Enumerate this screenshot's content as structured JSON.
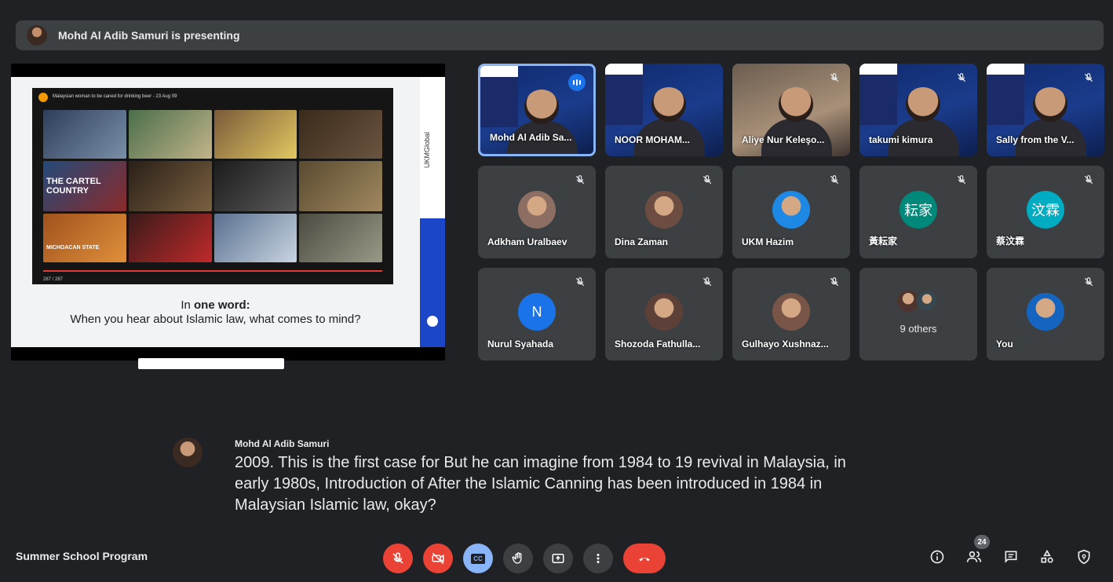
{
  "presenting_bar": {
    "text": "Mohd Al Adib Samuri is presenting"
  },
  "slide": {
    "video_title": "Malaysian woman to be caned for drinking beer - 23 Aug 09",
    "caption_prefix": "In ",
    "caption_bold": "one word:",
    "caption_line2": "When you hear about Islamic law, what comes to mind?",
    "tile_text_1": "THE CARTEL COUNTRY",
    "tile_text_2": "MICHOACAN STATE",
    "time": "287 / 287",
    "vertical_title": "UKMGlobal"
  },
  "tiles": [
    {
      "name": "Mohd Al Adib Sa...",
      "type": "video",
      "speaking": true
    },
    {
      "name": "NOOR MOHAM...",
      "type": "video",
      "muted": false
    },
    {
      "name": "Aliye Nur Keleşo...",
      "type": "video",
      "muted": true
    },
    {
      "name": "takumi kimura",
      "type": "video",
      "muted": true
    },
    {
      "name": "Sally from the V...",
      "type": "video",
      "muted": true
    },
    {
      "name": "Adkham Uralbaev",
      "type": "photo",
      "muted": true
    },
    {
      "name": "Dina Zaman",
      "type": "photo",
      "muted": true
    },
    {
      "name": "UKM Hazim",
      "type": "photo",
      "muted": true
    },
    {
      "name": "黃耘家",
      "type": "initials",
      "initials": "耘家",
      "muted": true
    },
    {
      "name": "蔡汶霖",
      "type": "initials",
      "initials": "汶霖",
      "muted": true
    },
    {
      "name": "Nurul Syahada",
      "type": "initials",
      "initials": "N",
      "muted": true
    },
    {
      "name": "Shozoda Fathulla...",
      "type": "photo",
      "muted": true
    },
    {
      "name": "Gulhayo Xushnaz...",
      "type": "photo",
      "muted": true
    },
    {
      "name": "9 others",
      "type": "others"
    },
    {
      "name": "You",
      "type": "photo",
      "muted": true
    }
  ],
  "captions": {
    "speaker": "Mohd Al Adib Samuri",
    "text": "2009. This is the first case for But he can imagine from 1984 to 19 revival in Malaysia, in early 1980s, Introduction of After the Islamic Canning has been introduced in 1984 in Malaysian Islamic law, okay?"
  },
  "footer": {
    "meeting_name": "Summer School Program",
    "participants_count": "24",
    "cc_label": "CC"
  },
  "colors": {
    "accent": "#8ab4f8",
    "danger": "#ea4335",
    "background": "#202124",
    "surface": "#3c4043"
  }
}
